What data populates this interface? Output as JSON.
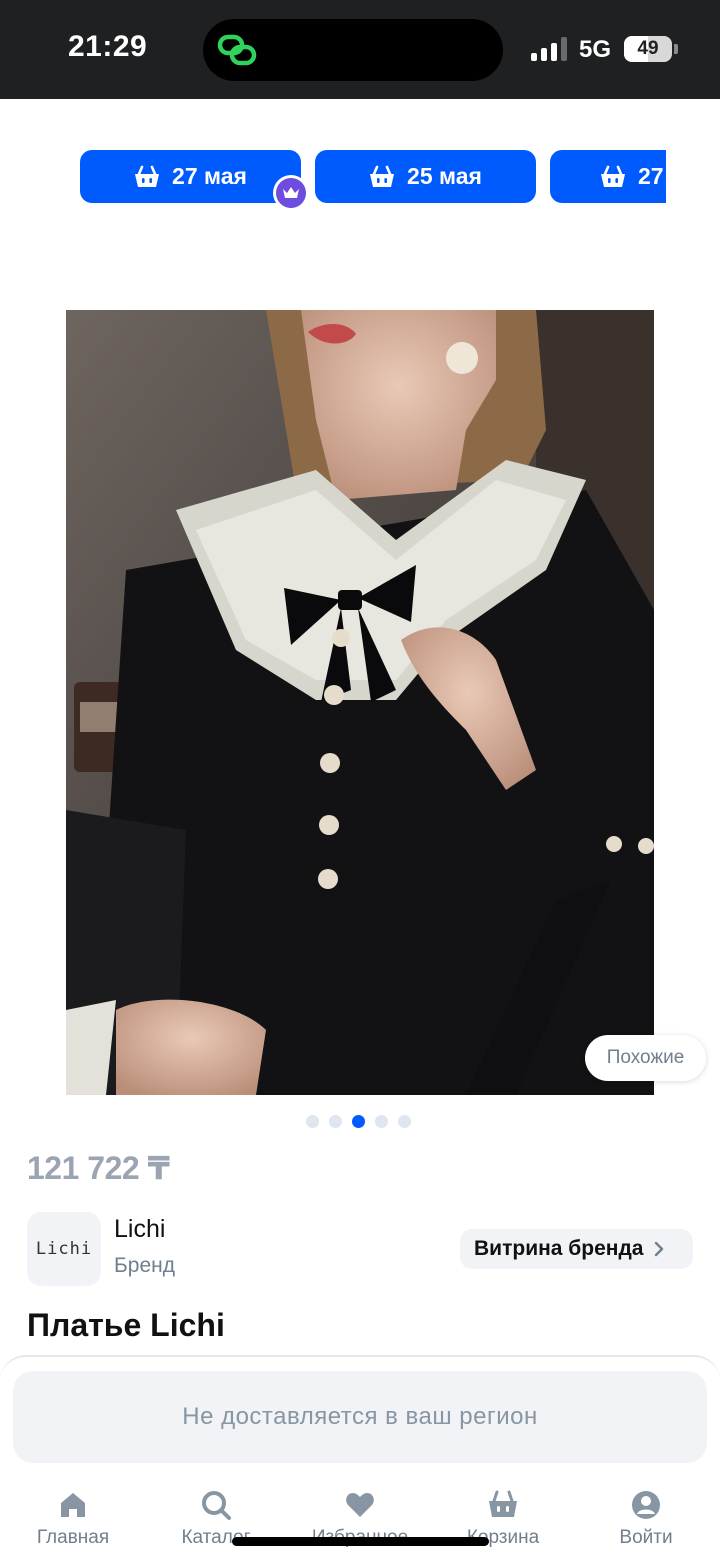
{
  "status_bar": {
    "time": "21:29",
    "network": "5G",
    "battery_percent": "49",
    "battery_level": 0.49,
    "signal_bars_active": 3
  },
  "delivery_chips": [
    {
      "label": "27 мая",
      "icon": "basket-icon"
    },
    {
      "label": "25 мая",
      "icon": "basket-icon"
    },
    {
      "label": "27",
      "icon": "basket-icon"
    }
  ],
  "product": {
    "similar_button": "Похожие",
    "gallery_total": 5,
    "gallery_current": 3,
    "price": "121 722 ₸",
    "title": "Платье Lichi"
  },
  "brand": {
    "logo_text": "Lichi",
    "name": "Lichi",
    "subtitle": "Бренд",
    "showcase_label": "Витрина бренда"
  },
  "notice": "Не доставляется в ваш регион",
  "tabbar": [
    {
      "label": "Главная",
      "icon": "home-icon"
    },
    {
      "label": "Каталог",
      "icon": "search-icon"
    },
    {
      "label": "Избранное",
      "icon": "heart-icon"
    },
    {
      "label": "Корзина",
      "icon": "basket-icon"
    },
    {
      "label": "Войти",
      "icon": "profile-icon"
    }
  ],
  "colors": {
    "accent": "#005bff",
    "muted_text": "#707f8d",
    "status_bar": "#1f2022",
    "premium_badge": "#6f4ce0"
  }
}
